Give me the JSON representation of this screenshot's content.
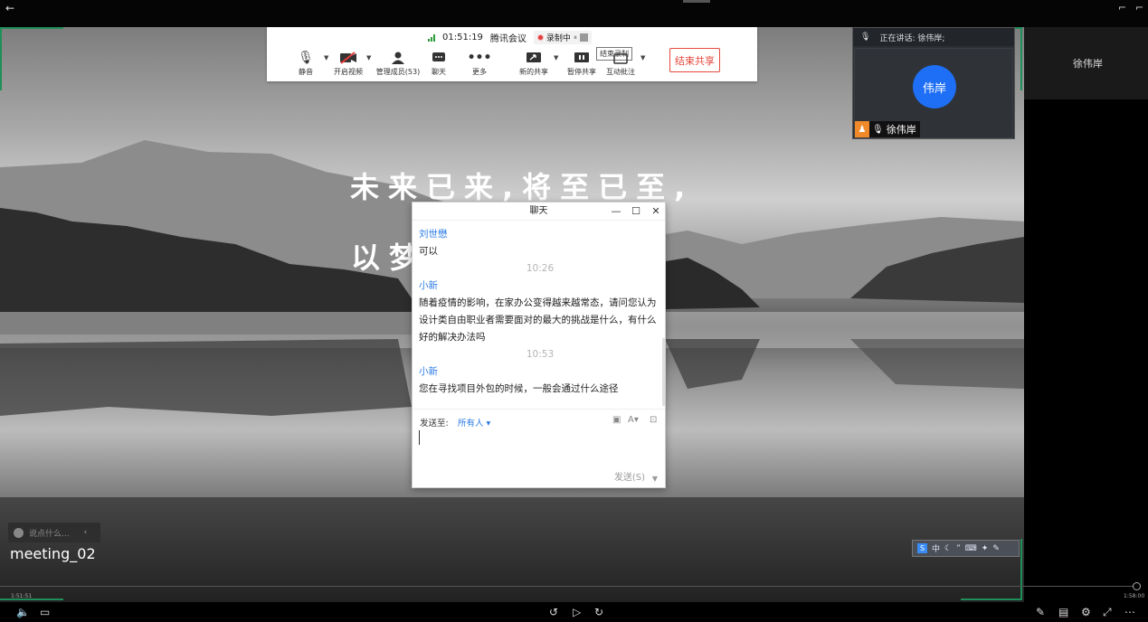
{
  "player": {
    "back_icon": "back-arrow-icon",
    "current_time": "1:51:51",
    "total_time": "1:58:00",
    "progress_fraction": 0.995
  },
  "toolbar": {
    "time": "01:51:19",
    "app_name": "腾讯会议",
    "recording_label": "录制中",
    "tooltip": "结束录制",
    "buttons": [
      {
        "label": "静音",
        "icon": "microphone-icon"
      },
      {
        "label": "开启视频",
        "icon": "video-off-icon"
      },
      {
        "label": "管理成员(53)",
        "icon": "members-icon"
      },
      {
        "label": "聊天",
        "icon": "chat-icon"
      },
      {
        "label": "更多",
        "icon": "more-icon"
      },
      {
        "label": "新的共享",
        "icon": "share-icon"
      },
      {
        "label": "暂停共享",
        "icon": "pause-icon"
      },
      {
        "label": "互动批注",
        "icon": "annotate-icon"
      }
    ],
    "end_share": "结束共享"
  },
  "speaker": {
    "header": "正在讲话: 徐伟岸;",
    "avatar_text": "伟岸",
    "name": "徐伟岸"
  },
  "right_strip": {
    "name": "徐伟岸"
  },
  "slogan": {
    "line1": "未来已来,将至已至,",
    "line2": "以梦"
  },
  "chat": {
    "title": "聊天",
    "messages": [
      {
        "type": "sender",
        "text": "刘世懋"
      },
      {
        "type": "text",
        "text": "可以"
      },
      {
        "type": "time",
        "text": "10:26"
      },
      {
        "type": "sender",
        "text": "小新"
      },
      {
        "type": "text",
        "text": "随着疫情的影响，在家办公变得越来越常态，请问您认为设计类自由职业者需要面对的最大的挑战是什么，有什么好的解决办法吗"
      },
      {
        "type": "time",
        "text": "10:53"
      },
      {
        "type": "sender",
        "text": "小新"
      },
      {
        "type": "text",
        "text": "您在寻找项目外包的时候，一般会通过什么途径"
      }
    ],
    "send_to_label": "发送至:",
    "send_to_value": "所有人",
    "send_button": "发送(S)"
  },
  "reaction": {
    "placeholder": "说点什么..."
  },
  "meeting_name": "meeting_02"
}
